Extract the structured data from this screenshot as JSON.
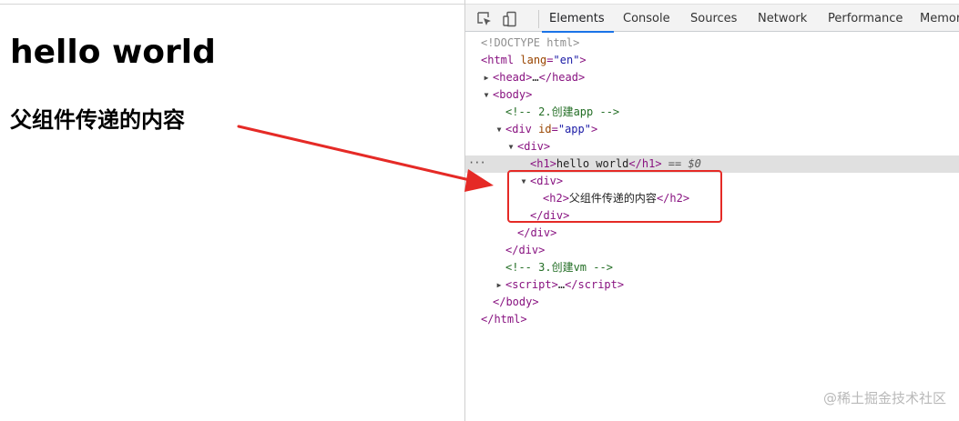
{
  "page": {
    "h1": "hello world",
    "h2": "父组件传递的内容"
  },
  "devtools": {
    "tabs": [
      "Elements",
      "Console",
      "Sources",
      "Network",
      "Performance",
      "Memor"
    ],
    "active_tab": "Elements",
    "icons": [
      "inspect-element-icon",
      "device-toolbar-icon"
    ],
    "tree": {
      "doctype": "<!DOCTYPE html>",
      "html_open_tag": "html",
      "html_lang_attr": "lang",
      "html_lang_val": "\"en\"",
      "head_tag": "head",
      "head_ellipsis": "…",
      "body_tag": "body",
      "comment_app": "<!-- 2.创建app   -->",
      "div_tag": "div",
      "div_id_attr": "id",
      "div_id_val": "\"app\"",
      "h1_tag": "h1",
      "h1_text": "hello world",
      "selected_marker": " == $0",
      "h2_tag": "h2",
      "h2_text": "父组件传递的内容",
      "comment_vm": "<!-- 3.创建vm   -->",
      "script_tag": "script",
      "script_ellipsis": "…",
      "ellipsis_dots": "···"
    }
  },
  "watermark": "@稀土掘金技术社区",
  "colors": {
    "highlight": "#e52a26",
    "tab_accent": "#1a73e8",
    "tag": "#881280",
    "attr_name": "#994500",
    "attr_value": "#1a1aa6",
    "comment": "#236e25"
  }
}
